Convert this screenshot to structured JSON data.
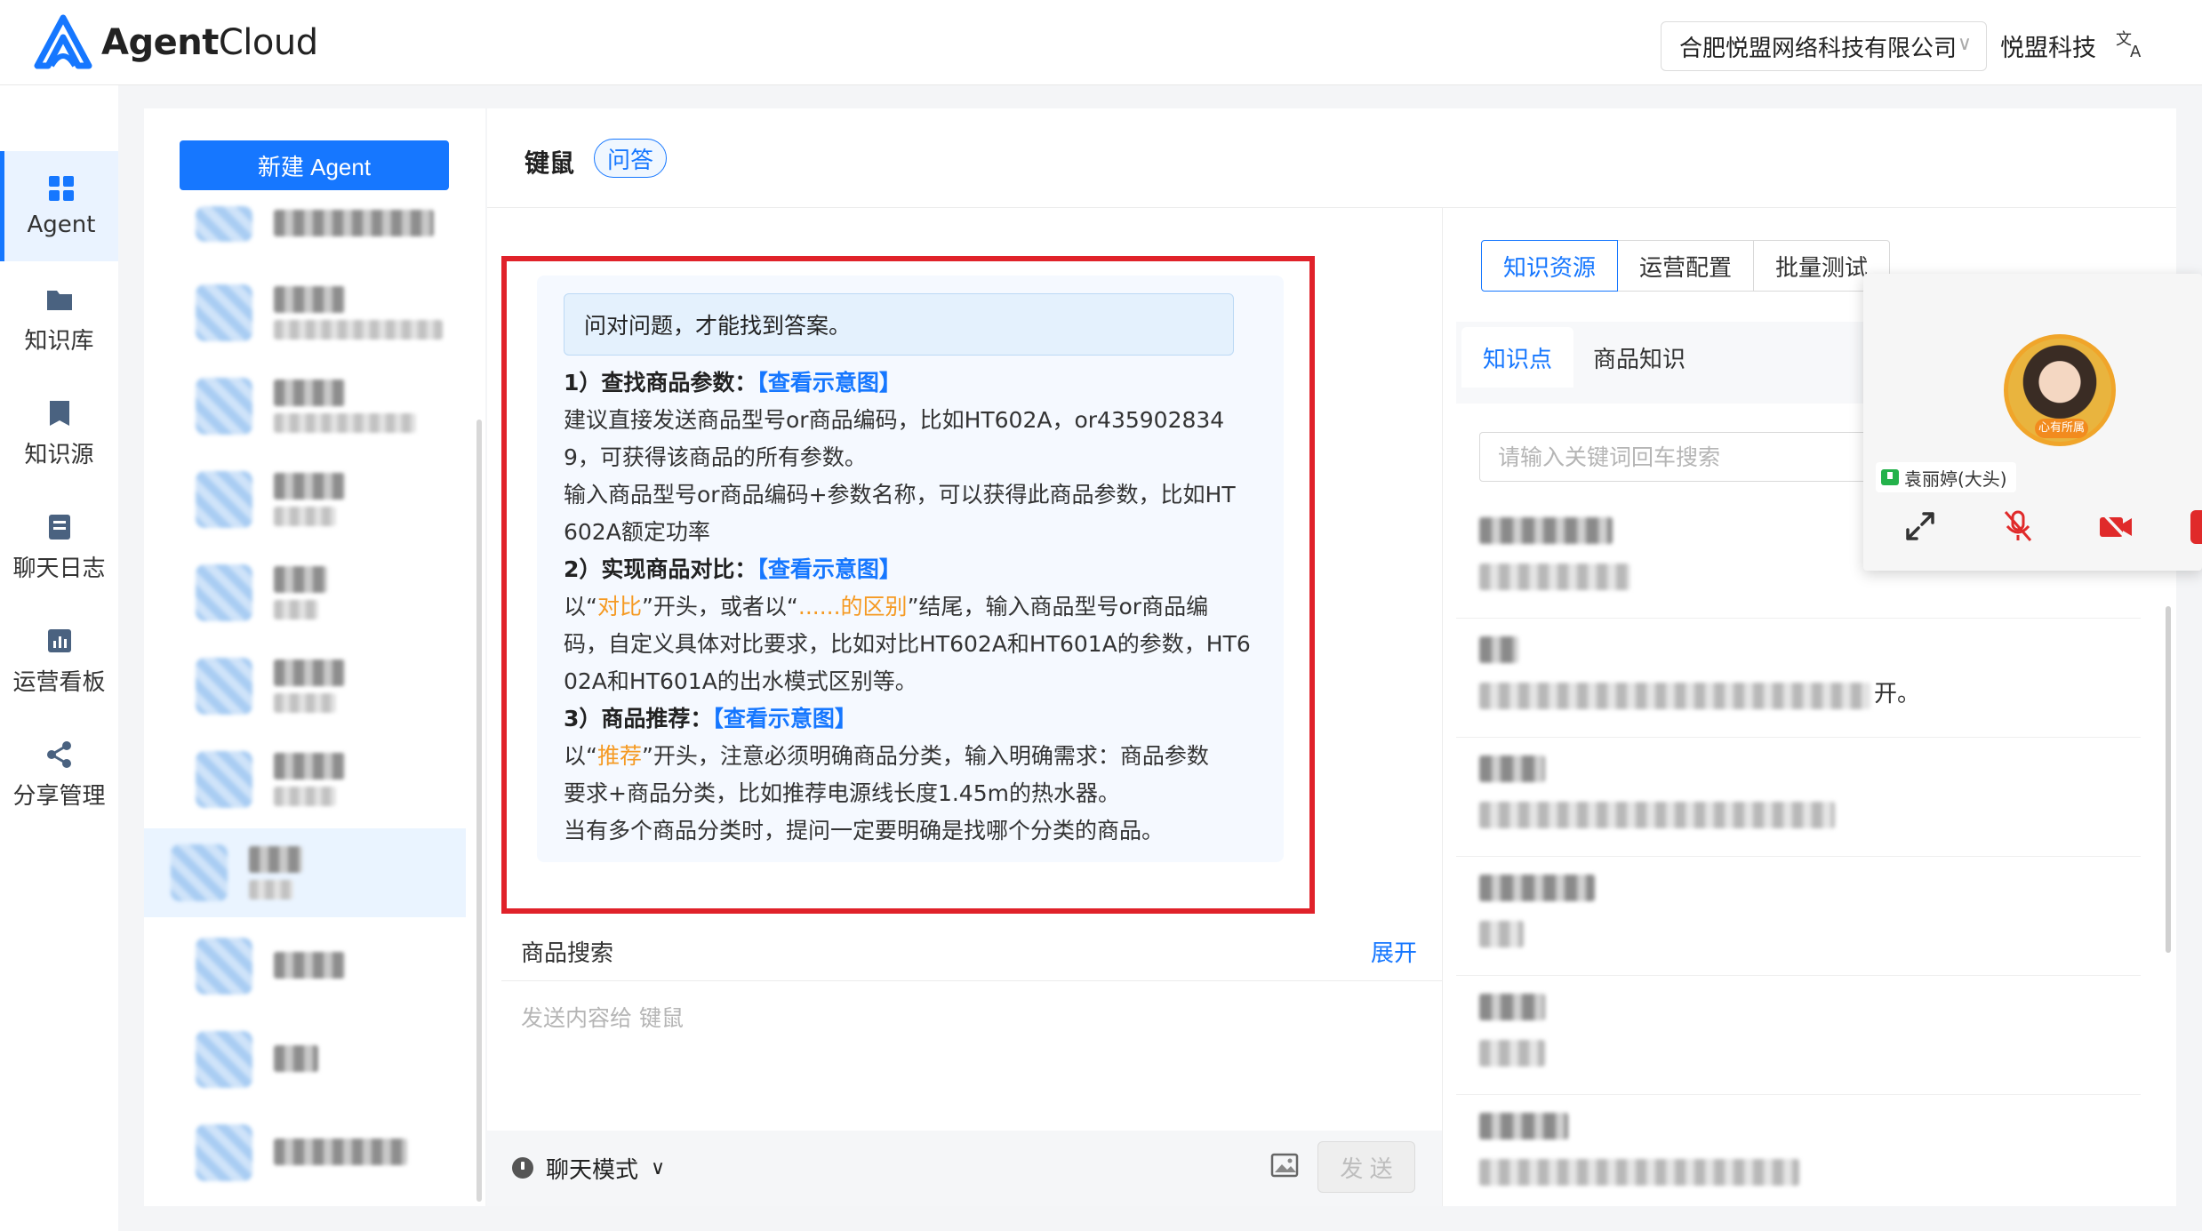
{
  "app": {
    "brand_bold": "Agent",
    "brand_light": "Cloud",
    "company": "合肥悦盟网络科技有限公司",
    "org_name": "悦盟科技",
    "accent_color": "#1677ff"
  },
  "nav": {
    "items": [
      {
        "label": "Agent",
        "icon": "grid-icon"
      },
      {
        "label": "知识库",
        "icon": "folder-icon"
      },
      {
        "label": "知识源",
        "icon": "book-icon"
      },
      {
        "label": "聊天日志",
        "icon": "log-icon"
      },
      {
        "label": "运营看板",
        "icon": "chart-icon"
      },
      {
        "label": "分享管理",
        "icon": "share-icon"
      }
    ]
  },
  "agents": {
    "new_button": "新建 Agent"
  },
  "chat": {
    "title": "键鼠",
    "tag": "问答",
    "tip": "问对问题，才能找到答案。",
    "guide": {
      "s1_title": "1）查找商品参数：",
      "s1_link": "【查看示意图】",
      "s1_line1": "建议直接发送商品型号or商品编码，比如HT602A，or435902834",
      "s1_line2": "9，可获得该商品的所有参数。",
      "s1_line3": "输入商品型号or商品编码+参数名称，可以获得此商品参数，比如HT",
      "s1_line4": "602A额定功率",
      "s2_title": "2）实现商品对比：",
      "s2_link": "【查看示意图】",
      "s2_a": "以“",
      "s2_b": "对比",
      "s2_c": "”开头，或者以“",
      "s2_d": "......的区别",
      "s2_e": "”结尾，输入商品型号or商品编",
      "s2_line2": "码，自定义具体对比要求，比如对比HT602A和HT601A的参数，HT6",
      "s2_line3": "02A和HT601A的出水模式区别等。",
      "s3_title": "3）商品推荐：",
      "s3_link": "【查看示意图】",
      "s3_a": "以“",
      "s3_b": "推荐",
      "s3_c": "”开头，注意必须明确商品分类，输入明确需求：商品参数",
      "s3_line2": "要求+商品分类，比如推荐电源线长度1.45m的热水器。",
      "s3_line3": "当有多个商品分类时，提问一定要明确是找哪个分类的商品。"
    },
    "search_label": "商品搜索",
    "expand": "展开",
    "input_placeholder": "发送内容给 键鼠",
    "mode": "聊天模式",
    "send": "发 送"
  },
  "knowledge": {
    "tabs": [
      "知识资源",
      "运营配置",
      "批量测试"
    ],
    "sub_tabs": [
      "知识点",
      "商品知识"
    ],
    "search_placeholder": "请输入关键词回车搜索",
    "row_tail": "开。"
  },
  "call": {
    "caller": "袁丽婷(大头)",
    "avatar_badge": "心有所属"
  }
}
